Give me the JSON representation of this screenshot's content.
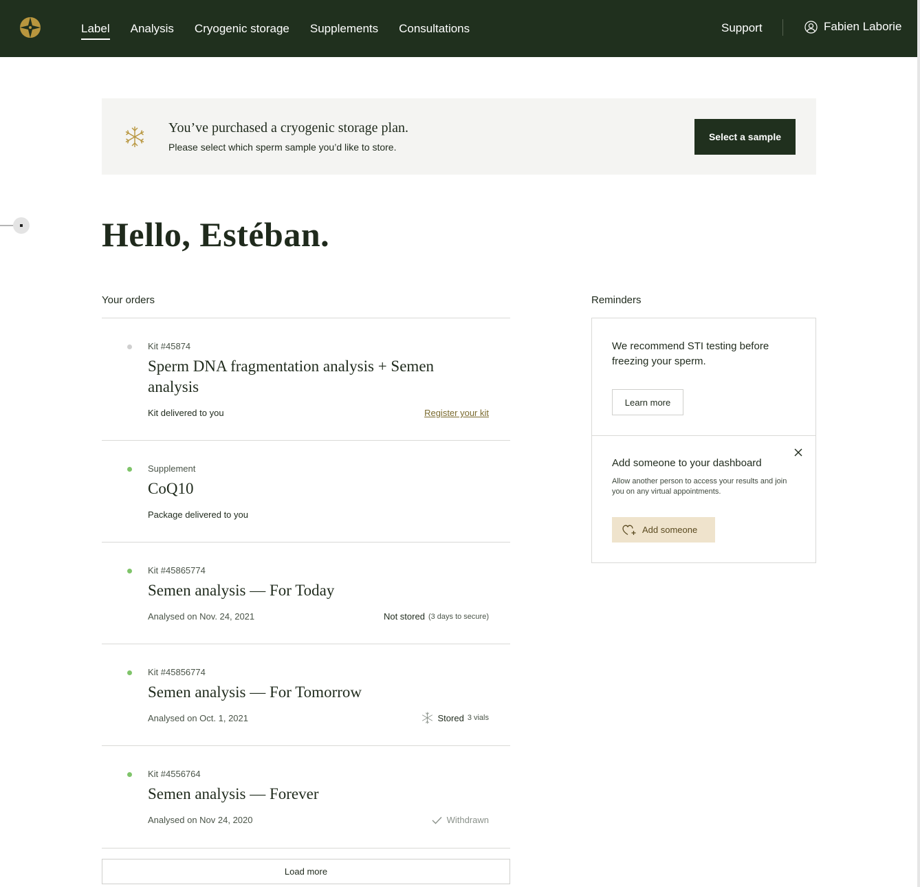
{
  "nav": {
    "items": [
      {
        "label": "Label",
        "active": true
      },
      {
        "label": "Analysis",
        "active": false
      },
      {
        "label": "Cryogenic storage",
        "active": false
      },
      {
        "label": "Supplements",
        "active": false
      },
      {
        "label": "Consultations",
        "active": false
      }
    ],
    "support_label": "Support",
    "user_name": "Fabien Laborie"
  },
  "banner": {
    "title": "You’ve purchased a cryogenic storage plan.",
    "subtitle": "Please select which sperm sample you’d like to store.",
    "button_label": "Select a sample"
  },
  "greeting": "Hello, Estéban.",
  "orders": {
    "title": "Your orders",
    "items": [
      {
        "kind": "Kit #45874",
        "name": "Sperm DNA fragmentation analysis + Semen analysis",
        "status": "Kit delivered to you",
        "action": "Register your kit"
      },
      {
        "kind": "Supplement",
        "name": "CoQ10",
        "status": "Package delivered to you"
      },
      {
        "kind": "Kit #45865774",
        "name": "Semen analysis — For Today",
        "status": "Analysed on Nov. 24, 2021",
        "storage": "Not stored",
        "storage_note": "(3 days to secure)"
      },
      {
        "kind": "Kit #45856774",
        "name": "Semen analysis — For Tomorrow",
        "status": "Analysed on Oct. 1, 2021",
        "storage": "Stored",
        "storage_note": "3 vials"
      },
      {
        "kind": "Kit #4556764",
        "name": "Semen analysis — Forever",
        "status": "Analysed on Nov 24, 2020",
        "storage": "Withdrawn"
      }
    ],
    "load_more_label": "Load more"
  },
  "reminders": {
    "title": "Reminders",
    "sti": {
      "text": "We recommend STI testing before freezing your sperm.",
      "button_label": "Learn more"
    },
    "add_person": {
      "title": "Add someone to your dashboard",
      "text": "Allow another person to access your results and join you on any virtual appointments.",
      "button_label": "Add someone"
    }
  },
  "colors": {
    "nav_bg": "#20301e",
    "accent_gold": "#b8963e",
    "status_green": "#7fc46a",
    "banner_bg": "#f4f4f2",
    "beige_button": "#efe3cc"
  }
}
